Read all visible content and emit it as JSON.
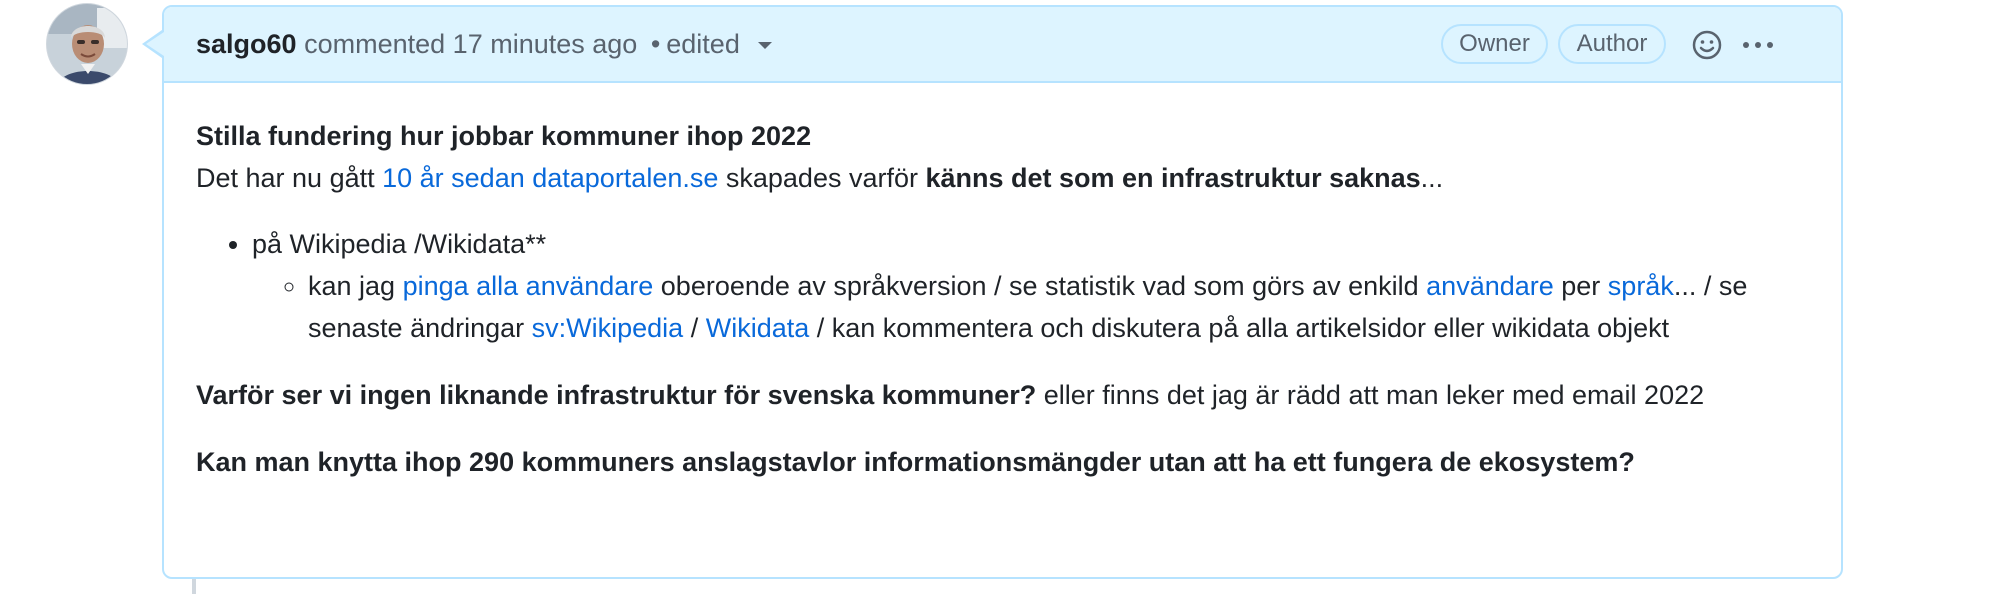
{
  "comment": {
    "author": "salgo60",
    "action": "commented",
    "time": "17 minutes ago",
    "separator": "•",
    "edited": "edited",
    "badges": {
      "owner": "Owner",
      "author": "Author"
    },
    "icons": {
      "avatar": "user-avatar",
      "reaction": "smiley-icon",
      "more": "kebab-horizontal-icon",
      "edit_history": "triangle-down-icon"
    }
  },
  "body": {
    "heading": "Stilla fundering hur jobbar kommuner ihop 2022",
    "p1_prefix": "Det har nu gått ",
    "p1_link": "10 år sedan dataportalen.se",
    "p1_middle": " skapades varför ",
    "p1_bold": "känns det som en infrastruktur saknas",
    "p1_suffix": "...",
    "list_item": "på Wikipedia /Wikidata**",
    "sub_1": "kan jag ",
    "sub_link_ping": "pinga alla användare",
    "sub_2": " oberoende av språkversion / se statistik vad som görs av enkild ",
    "sub_link_user": "användare",
    "sub_3": " per ",
    "sub_link_lang": "språk",
    "sub_4": "... / se senaste ändringar ",
    "sub_link_svwp": "sv:Wikipedia",
    "sub_5": " / ",
    "sub_link_wd": "Wikidata",
    "sub_6": " / kan kommentera och diskutera på alla artikelsidor eller wikidata objekt",
    "p2_bold": "Varför ser vi ingen liknande infrastruktur för svenska kommuner?",
    "p2_rest": " eller finns det jag är rädd att man leker med email 2022",
    "p3_bold": "Kan man knytta ihop 290 kommuners anslagstavlor informationsmängder utan att ha ett fungera de ekosystem?"
  },
  "colors": {
    "header_bg": "#ddf4ff",
    "border": "#b6e3ff",
    "link": "#0969da",
    "text": "#1f2328",
    "muted": "#59636e"
  }
}
